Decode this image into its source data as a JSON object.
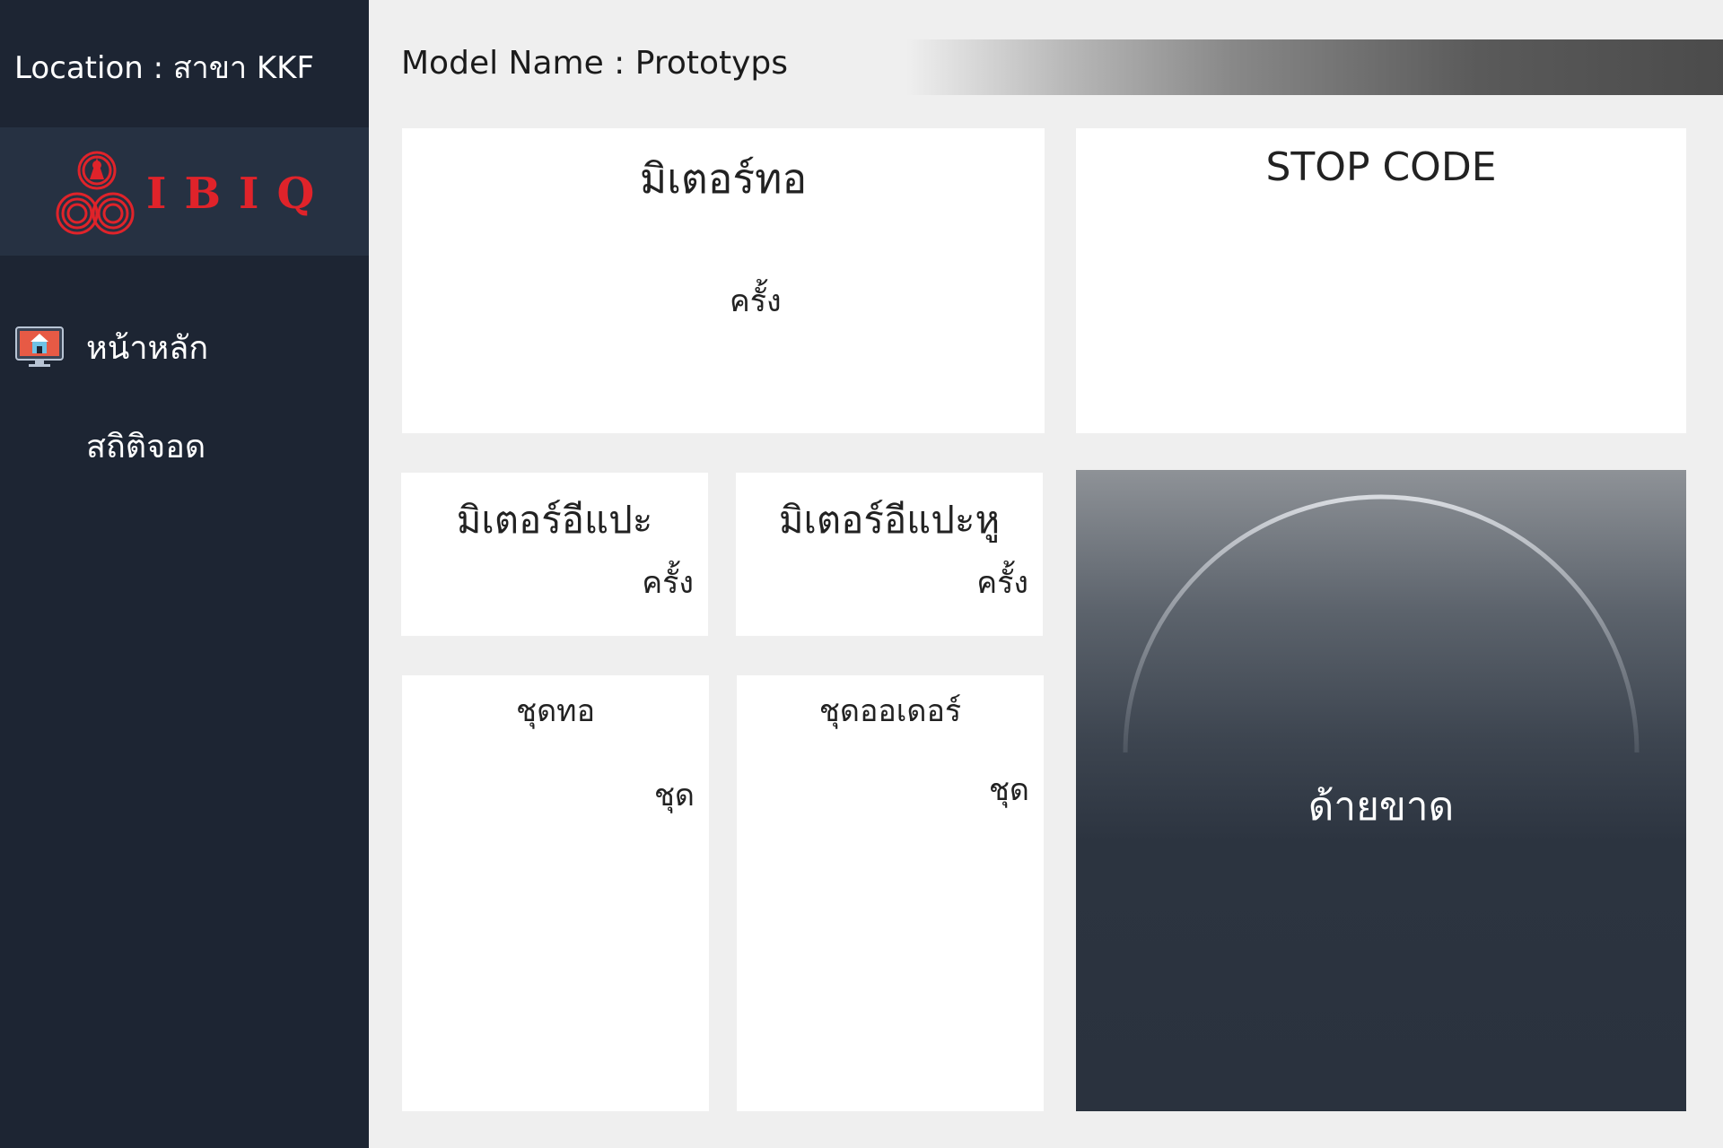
{
  "sidebar": {
    "location": "Location : สาขา KKF",
    "logo_text": "IBIQ",
    "items": [
      {
        "label": "หน้าหลัก",
        "icon": "home-monitor-icon"
      },
      {
        "label": "สถิติจอด",
        "icon": ""
      }
    ]
  },
  "header": {
    "model_name": "Model Name : Prototyps"
  },
  "cards": {
    "meter_tho": {
      "title": "มิเตอร์ทอ",
      "unit": "ครั้ง"
    },
    "stop_code": {
      "title": "STOP CODE"
    },
    "meter_ee_pae": {
      "title": "มิเตอร์อีแปะ",
      "unit": "ครั้ง"
    },
    "meter_ee_pae_hu": {
      "title": "มิเตอร์อีแปะหู",
      "unit": "ครั้ง"
    },
    "chud_tho": {
      "title": "ชุดทอ",
      "unit": "ชุด"
    },
    "chud_order": {
      "title": "ชุดออเดอร์",
      "unit": "ชุด"
    }
  },
  "gauge": {
    "label": "ด้ายขาด"
  },
  "colors": {
    "sidebar_bg": "#1d2533",
    "logo_red": "#e0232a",
    "page_bg": "#efefef"
  }
}
